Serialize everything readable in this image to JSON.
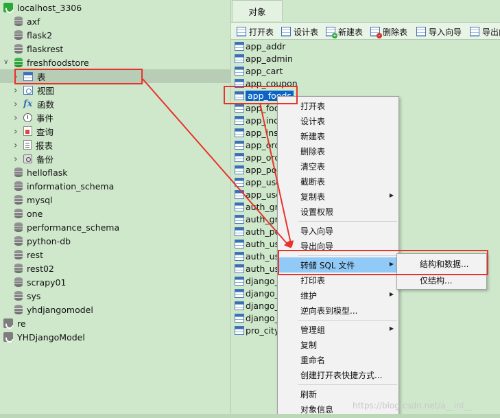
{
  "tree": {
    "connection": "localhost_3306",
    "databases_before": [
      "axf",
      "flask2",
      "flaskrest"
    ],
    "open_database": "freshfoodstore",
    "categories": [
      {
        "label": "表",
        "icon": "table-icon"
      },
      {
        "label": "视图",
        "icon": "view-icon"
      },
      {
        "label": "函数",
        "icon": "function-icon"
      },
      {
        "label": "事件",
        "icon": "event-icon"
      },
      {
        "label": "查询",
        "icon": "query-icon"
      },
      {
        "label": "报表",
        "icon": "report-icon"
      },
      {
        "label": "备份",
        "icon": "backup-icon"
      }
    ],
    "databases_after": [
      "helloflask",
      "information_schema",
      "mysql",
      "one",
      "performance_schema",
      "python-db",
      "rest",
      "rest02",
      "scrapy01",
      "sys",
      "yhdjangomodel"
    ],
    "other_connections": [
      "re",
      "YHDjangoModel"
    ]
  },
  "objects_tab": "对象",
  "toolbar": [
    {
      "label": "打开表",
      "icon": "open-table-icon"
    },
    {
      "label": "设计表",
      "icon": "design-table-icon"
    },
    {
      "label": "新建表",
      "icon": "new-table-icon"
    },
    {
      "label": "删除表",
      "icon": "delete-table-icon"
    },
    {
      "label": "导入向导",
      "icon": "import-wizard-icon"
    },
    {
      "label": "导出向导",
      "icon": "export-wizard-icon"
    }
  ],
  "tables": [
    "app_addr",
    "app_admin",
    "app_cart",
    "app_coupon",
    "app_foods",
    "app_foo",
    "app_ind",
    "app_ins",
    "app_ord",
    "app_ord",
    "app_pol",
    "app_use",
    "app_use",
    "auth_gro",
    "auth_gro",
    "auth_pe",
    "auth_use",
    "auth_use",
    "auth_use",
    "django_",
    "django_",
    "django_",
    "django_",
    "pro_city"
  ],
  "selected_table": "app_foods",
  "context_menu": {
    "items": [
      {
        "label": "打开表"
      },
      {
        "label": "设计表"
      },
      {
        "label": "新建表"
      },
      {
        "label": "删除表"
      },
      {
        "label": "清空表"
      },
      {
        "label": "截断表"
      },
      {
        "label": "复制表",
        "submenu": true
      },
      {
        "label": "设置权限"
      },
      {
        "sep": true
      },
      {
        "label": "导入向导"
      },
      {
        "label": "导出向导"
      },
      {
        "sep": true
      },
      {
        "label": "转储 SQL 文件",
        "submenu": true,
        "highlight": true
      },
      {
        "label": "打印表"
      },
      {
        "label": "维护",
        "submenu": true
      },
      {
        "label": "逆向表到模型..."
      },
      {
        "sep": true
      },
      {
        "label": "管理组",
        "submenu": true
      },
      {
        "label": "复制"
      },
      {
        "label": "重命名"
      },
      {
        "label": "创建打开表快捷方式..."
      },
      {
        "sep": true
      },
      {
        "label": "刷新"
      },
      {
        "label": "对象信息"
      }
    ],
    "dump_submenu": [
      "结构和数据...",
      "仅结构..."
    ]
  },
  "watermark": "https://blog.csdn.net/a__int__",
  "colors": {
    "annotation": "#e8322a",
    "selection": "#0a64c8",
    "highlight": "#91c9f7",
    "panel": "#cfe8cc"
  }
}
